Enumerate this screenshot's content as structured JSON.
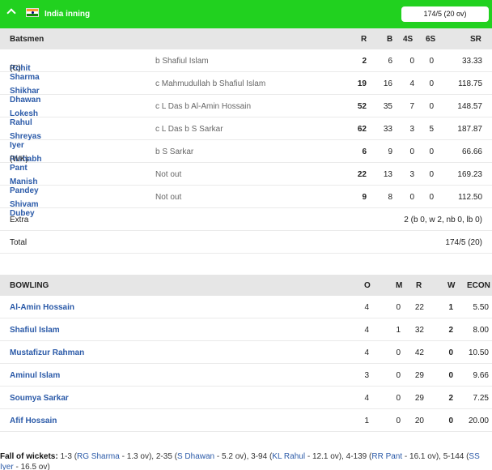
{
  "header": {
    "title": "India inning",
    "score": "174/5 (20 ov)",
    "colors": {
      "bar": "#21d11f",
      "link": "#2b5aa8"
    },
    "icons": [
      "chevron-up-icon",
      "india-flag-icon"
    ]
  },
  "batting": {
    "title": "Batsmen",
    "columns": [
      "R",
      "B",
      "4S",
      "6S",
      "SR"
    ],
    "rows": [
      {
        "name": "Rohit Sharma",
        "tag": "(C)",
        "dismissal": "b Shafiul Islam",
        "r": "2",
        "b": "6",
        "fours": "0",
        "sixes": "0",
        "sr": "33.33"
      },
      {
        "name": "Shikhar Dhawan",
        "tag": "",
        "dismissal": "c Mahmudullah b Shafiul Islam",
        "r": "19",
        "b": "16",
        "fours": "4",
        "sixes": "0",
        "sr": "118.75"
      },
      {
        "name": "Lokesh Rahul",
        "tag": "",
        "dismissal": "c L Das b Al-Amin Hossain",
        "r": "52",
        "b": "35",
        "fours": "7",
        "sixes": "0",
        "sr": "148.57"
      },
      {
        "name": "Shreyas Iyer",
        "tag": "",
        "dismissal": "c L Das b S Sarkar",
        "r": "62",
        "b": "33",
        "fours": "3",
        "sixes": "5",
        "sr": "187.87"
      },
      {
        "name": "Rishabh Pant",
        "tag": "(WK)",
        "dismissal": "b S Sarkar",
        "r": "6",
        "b": "9",
        "fours": "0",
        "sixes": "0",
        "sr": "66.66"
      },
      {
        "name": "Manish Pandey",
        "tag": "",
        "dismissal": "Not out",
        "r": "22",
        "b": "13",
        "fours": "3",
        "sixes": "0",
        "sr": "169.23"
      },
      {
        "name": "Shivam Dubey",
        "tag": "",
        "dismissal": "Not out",
        "r": "9",
        "b": "8",
        "fours": "0",
        "sixes": "0",
        "sr": "112.50"
      }
    ],
    "extra_label": "Extra",
    "extra_value": "2 (b 0, w 2, nb 0, lb 0)",
    "total_label": "Total",
    "total_value": "174/5 (20)"
  },
  "bowling": {
    "title": "BOWLING",
    "columns": [
      "O",
      "M",
      "R",
      "W",
      "ECON"
    ],
    "rows": [
      {
        "name": "Al-Amin Hossain",
        "o": "4",
        "m": "0",
        "r": "22",
        "w": "1",
        "econ": "5.50"
      },
      {
        "name": "Shafiul Islam",
        "o": "4",
        "m": "1",
        "r": "32",
        "w": "2",
        "econ": "8.00"
      },
      {
        "name": "Mustafizur Rahman",
        "o": "4",
        "m": "0",
        "r": "42",
        "w": "0",
        "econ": "10.50"
      },
      {
        "name": "Aminul Islam",
        "o": "3",
        "m": "0",
        "r": "29",
        "w": "0",
        "econ": "9.66"
      },
      {
        "name": "Soumya Sarkar",
        "o": "4",
        "m": "0",
        "r": "29",
        "w": "2",
        "econ": "7.25"
      },
      {
        "name": "Afif Hossain",
        "o": "1",
        "m": "0",
        "r": "20",
        "w": "0",
        "econ": "20.00"
      }
    ]
  },
  "fall_of_wickets": {
    "label": "Fall of wickets:",
    "items": [
      {
        "score": "1-3",
        "batsman": "RG Sharma",
        "over": "1.3 ov"
      },
      {
        "score": "2-35",
        "batsman": "S Dhawan",
        "over": "5.2 ov"
      },
      {
        "score": "3-94",
        "batsman": "KL Rahul",
        "over": "12.1 ov"
      },
      {
        "score": "4-139",
        "batsman": "RR Pant",
        "over": "16.1 ov"
      },
      {
        "score": "5-144",
        "batsman": "SS Iyer",
        "over": "16.5 ov"
      }
    ]
  }
}
